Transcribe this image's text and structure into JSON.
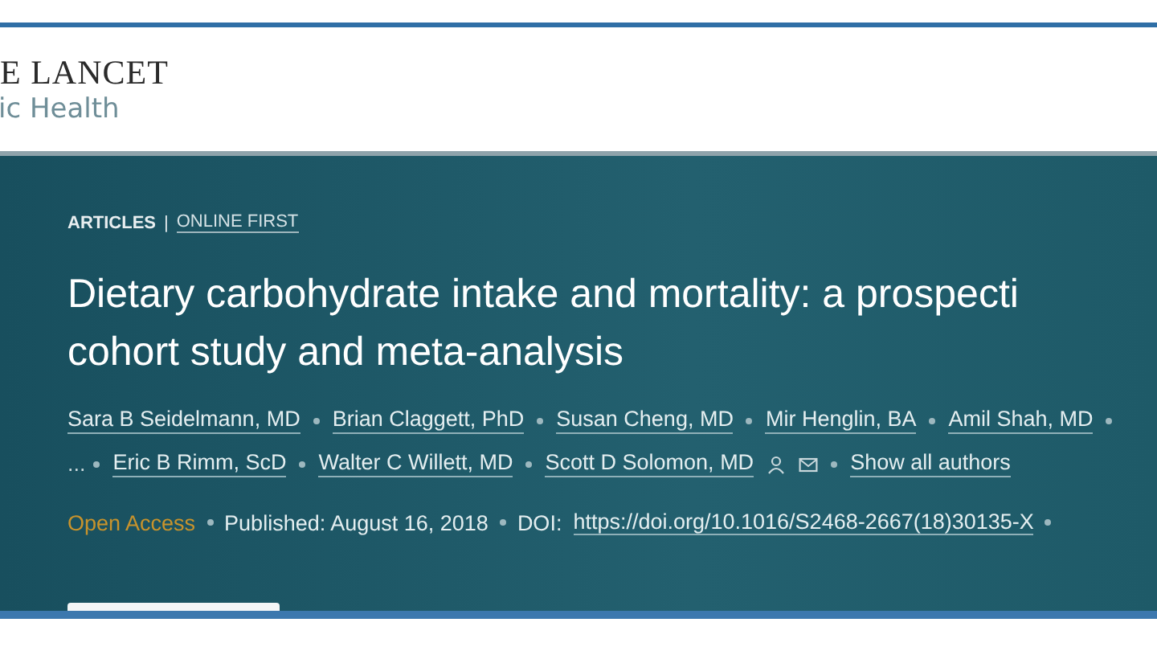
{
  "logo": {
    "line1": "E LANCET",
    "line2": "ic Health"
  },
  "article": {
    "type": "ARTICLES",
    "divider": "|",
    "status": "ONLINE FIRST",
    "title": [
      "Dietary carbohydrate intake and mortality: a prospecti",
      "cohort study and meta-analysis"
    ],
    "author_lines": [
      {
        "items": [
          {
            "kind": "author",
            "text": "Sara B Seidelmann, MD"
          },
          {
            "kind": "author",
            "text": "Brian Claggett, PhD"
          },
          {
            "kind": "author",
            "text": "Susan Cheng, MD"
          },
          {
            "kind": "author",
            "text": "Mir Henglin, BA"
          },
          {
            "kind": "author",
            "text": "Amil Shah, MD"
          }
        ],
        "trailing_dot": true
      },
      {
        "items": [
          {
            "kind": "ellipsis",
            "text": "..."
          },
          {
            "kind": "author",
            "text": "Eric B Rimm, ScD"
          },
          {
            "kind": "author",
            "text": "Walter C Willett, MD"
          },
          {
            "kind": "author_contact",
            "text": "Scott D Solomon, MD"
          },
          {
            "kind": "link",
            "text": "Show all authors"
          }
        ],
        "trailing_dot": false
      }
    ],
    "access": "Open Access",
    "published": "Published: August 16, 2018",
    "doi_label": "DOI:",
    "doi": "https://doi.org/10.1016/S2468-2667(18)30135-X"
  }
}
